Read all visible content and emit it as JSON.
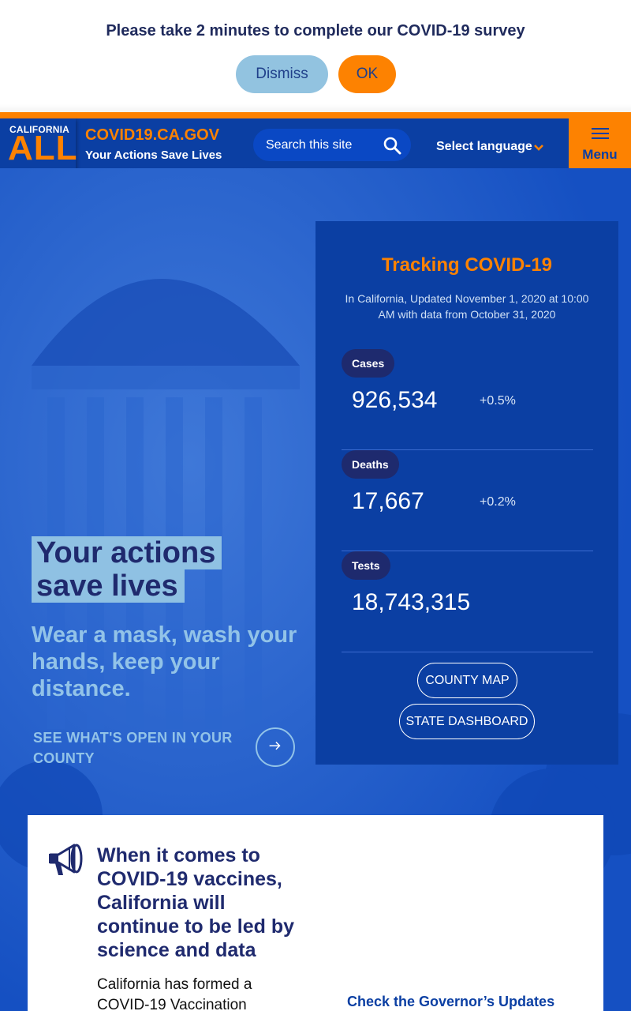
{
  "survey": {
    "message": "Please take 2 minutes to complete our COVID-19 survey",
    "dismiss_label": "Dismiss",
    "ok_label": "OK"
  },
  "header": {
    "logo_top": "CALIFORNIA",
    "logo_main": "ALL",
    "site_title": "COVID19.CA.GOV",
    "tagline": "Your Actions Save Lives",
    "search_placeholder": "Search this site",
    "language_label": "Select language",
    "menu_label": "Menu"
  },
  "hero": {
    "headline_line1": "Your actions",
    "headline_line2": "save lives",
    "subhead": "Wear a mask, wash your hands, keep your distance.",
    "open_link": "SEE WHAT'S OPEN IN YOUR COUNTY"
  },
  "tracking": {
    "title": "Tracking COVID-19",
    "updated": "In California, Updated November 1, 2020 at 10:00 AM with data from October 31, 2020",
    "stats": [
      {
        "label": "Cases",
        "value": "926,534",
        "change": "+0.5%"
      },
      {
        "label": "Deaths",
        "value": "17,667",
        "change": "+0.2%"
      },
      {
        "label": "Tests",
        "value": "18,743,315",
        "change": ""
      }
    ],
    "county_map_label": "COUNTY MAP",
    "state_dashboard_label": "STATE DASHBOARD"
  },
  "vaccine": {
    "title": "When it comes to COVID-19 vaccines, California will continue to be led by science and data",
    "body": "California has formed a COVID-19 Vaccination",
    "link": "Check the Governor’s Updates"
  },
  "colors": {
    "brand_blue": "#0b3fa3",
    "brand_orange": "#fd8201",
    "light_blue": "#92c3e0",
    "navy": "#1f2a6e"
  }
}
